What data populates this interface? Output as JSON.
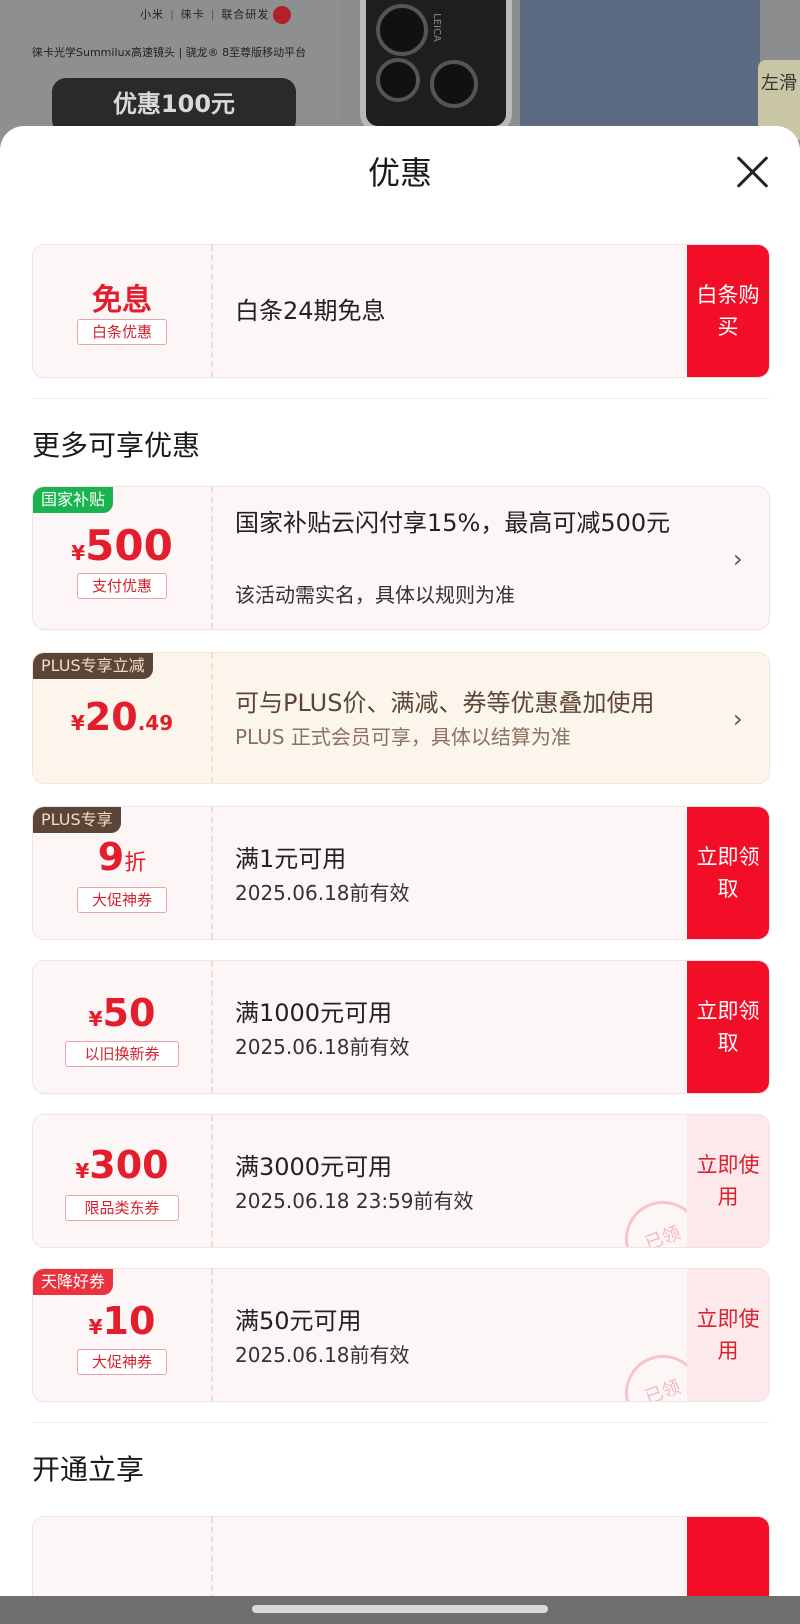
{
  "banner": {
    "brand_a": "小米",
    "brand_b": "徕卡",
    "brand_c": "联合研发",
    "spec": "徕卡光学Summilux高速镜头 | 骁龙® 8至尊版移动平台",
    "promo": "优惠100元",
    "side_tag": "左滑",
    "phone_mark": "LEICA"
  },
  "sheet": {
    "title": "优惠"
  },
  "installment": {
    "amount": "免息",
    "tag": "白条优惠",
    "text": "白条24期免息",
    "action": "白条购买"
  },
  "more_section": "更多可享优惠",
  "subsidy": {
    "corner": "国家补贴",
    "yen": "¥",
    "amount": "500",
    "tag": "支付优惠",
    "title": "国家补贴云闪付享15%，最高可减500元",
    "desc": "该活动需实名，具体以规则为准"
  },
  "plus_discount": {
    "corner": "PLUS专享立减",
    "yen": "¥",
    "amount": "20",
    "decimal": ".49",
    "title": "可与PLUS价、满减、券等优惠叠加使用",
    "desc": "PLUS 正式会员可享，具体以结算为准"
  },
  "coupons": [
    {
      "corner": "PLUS专享",
      "amount": "9",
      "unit": "折",
      "tag": "大促神券",
      "condition": "满1元可用",
      "validity": "2025.06.18前有效",
      "action": "立即领取"
    },
    {
      "yen": "¥",
      "amount": "50",
      "tag": "以旧换新券",
      "condition": "满1000元可用",
      "validity": "2025.06.18前有效",
      "action": "立即领取"
    },
    {
      "yen": "¥",
      "amount": "300",
      "tag": "限品类东券",
      "condition": "满3000元可用",
      "validity": "2025.06.18 23:59前有效",
      "action": "立即使用",
      "stamp": "已领"
    },
    {
      "corner": "天降好券",
      "yen": "¥",
      "amount": "10",
      "tag": "大促神券",
      "condition": "满50元可用",
      "validity": "2025.06.18前有效",
      "action": "立即使用",
      "stamp": "已领"
    }
  ],
  "open_section": "开通立享",
  "colors": {
    "accent_red": "#f10e26",
    "price_red": "#e41d2d",
    "green_tag": "#19b34f",
    "plus_brown": "#5a4538"
  }
}
